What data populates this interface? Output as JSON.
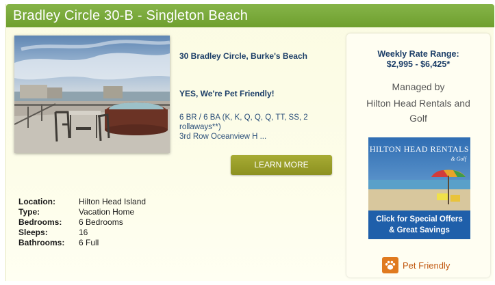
{
  "listing": {
    "title": "Bradley Circle 30-B - Singleton Beach",
    "address": "30 Bradley Circle, Burke's Beach",
    "pet_line": "YES, We're Pet Friendly!",
    "description_line1": "6 BR / 6 BA (K, K, Q, Q, Q, TT, SS, 2",
    "description_line2": "rollaways**)",
    "description_line3": "3rd Row Oceanview H ...",
    "learn_more_label": "LEARN MORE"
  },
  "details": [
    {
      "label": "Location:",
      "value": "Hilton Head Island"
    },
    {
      "label": "Type:",
      "value": "Vacation Home"
    },
    {
      "label": "Bedrooms:",
      "value": "6 Bedrooms"
    },
    {
      "label": "Sleeps:",
      "value": "16"
    },
    {
      "label": "Bathrooms:",
      "value": "6 Full"
    }
  ],
  "sidebar": {
    "rate_title": "Weekly Rate Range:",
    "rate_range": "$2,995 - $6,425*",
    "managed_by": "Managed by",
    "manager_line1": "Hilton Head Rentals and",
    "manager_line2": "Golf",
    "ad": {
      "brand": "HILTON HEAD RENTALS",
      "brand_sub": "& Golf",
      "cta_line1": "Click for Special Offers",
      "cta_line2": "& Great Savings"
    },
    "pet_friendly_label": "Pet Friendly"
  },
  "colors": {
    "title_bar": "#7aaa3c",
    "button": "#9a9e2a",
    "text_blue": "#1b3d67",
    "pet_orange": "#e07a1f",
    "ad_blue": "#1f5faa"
  },
  "icons": [
    "paw-icon"
  ]
}
